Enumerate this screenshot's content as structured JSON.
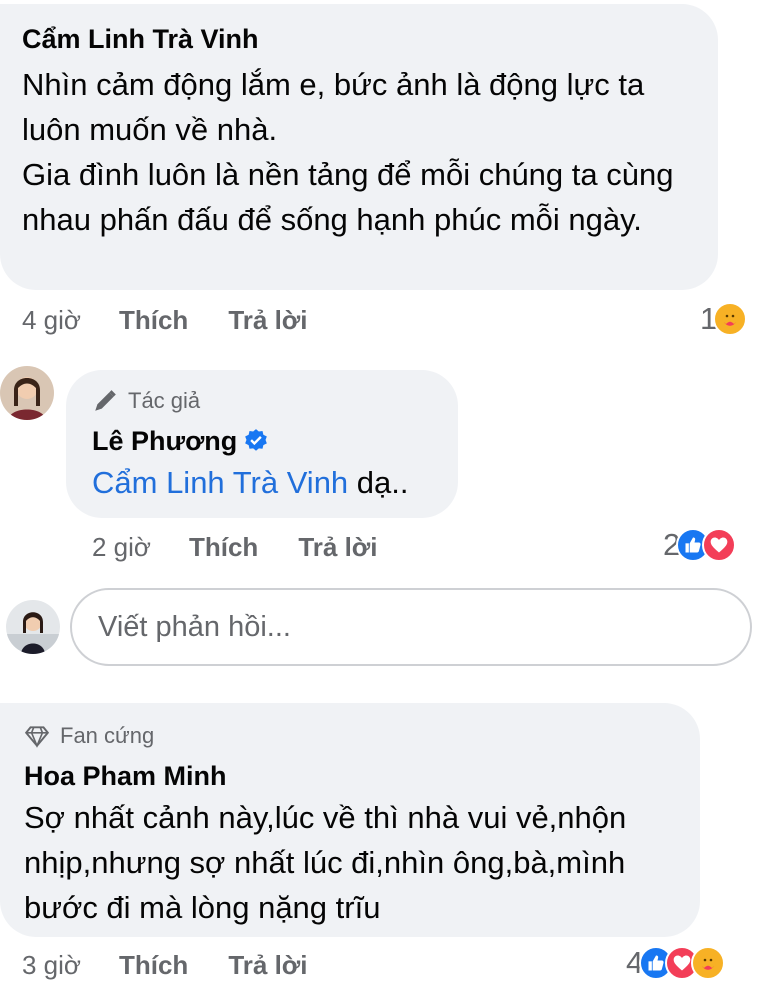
{
  "comments": [
    {
      "author": "Cẩm Linh Trà Vinh",
      "text": "Nhìn cảm động lắm e, bức ảnh là động lực ta luôn muốn về nhà.\nGia đình luôn là nền tảng để mỗi chúng ta cùng nhau phấn đấu để sống hạnh phúc mỗi ngày.",
      "time": "4 giờ",
      "like_label": "Thích",
      "reply_label": "Trả lời",
      "reaction_count": "1",
      "reactions": [
        "care-icon"
      ]
    },
    {
      "badge": "Tác giả",
      "author": "Lê Phương",
      "mention": "Cẩm Linh Trà Vinh",
      "text": " dạ..",
      "time": "2 giờ",
      "like_label": "Thích",
      "reply_label": "Trả lời",
      "reaction_count": "2",
      "reactions": [
        "like-icon",
        "love-icon"
      ]
    },
    {
      "badge": "Fan cứng",
      "author": "Hoa Pham Minh",
      "text": "Sợ nhất cảnh này,lúc về thì nhà vui vẻ,nhộn nhịp,nhưng sợ nhất lúc đi,nhìn ông,bà,mình bước đi mà lòng nặng trĩu",
      "time": "3 giờ",
      "like_label": "Thích",
      "reply_label": "Trả lời",
      "reaction_count": "4",
      "reactions": [
        "like-icon",
        "love-icon",
        "care-icon"
      ]
    }
  ],
  "reply_input": {
    "placeholder": "Viết phản hồi..."
  },
  "colors": {
    "bubble": "#f0f2f5",
    "link": "#216fdb",
    "like": "#1877f2",
    "love": "#f33e58",
    "care": "#f7b125",
    "meta": "#65676b"
  }
}
